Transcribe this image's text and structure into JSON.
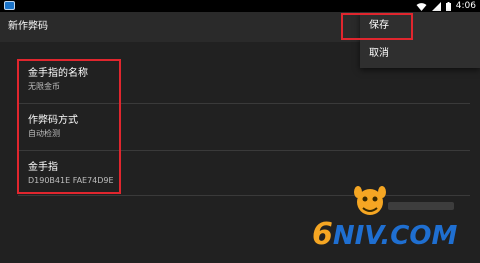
{
  "status_bar": {
    "time": "4:06",
    "icons": [
      "app-icon",
      "wifi-icon",
      "signal-icon",
      "battery-icon"
    ]
  },
  "action_bar": {
    "title": "新作弊码"
  },
  "menu": {
    "save_label": "保存",
    "cancel_label": "取消"
  },
  "settings": {
    "items": [
      {
        "title": "金手指的名称",
        "summary": "无限金币"
      },
      {
        "title": "作弊码方式",
        "summary": "自动检测"
      },
      {
        "title": "金手指",
        "summary": "D190B41E FAE74D9E"
      }
    ]
  },
  "watermark": {
    "text": "6NIV.COM",
    "colors": {
      "six": "#f5a623",
      "niv": "#1f6fd1"
    }
  },
  "colors": {
    "background": "#212121",
    "highlight_box": "#e0262e"
  }
}
